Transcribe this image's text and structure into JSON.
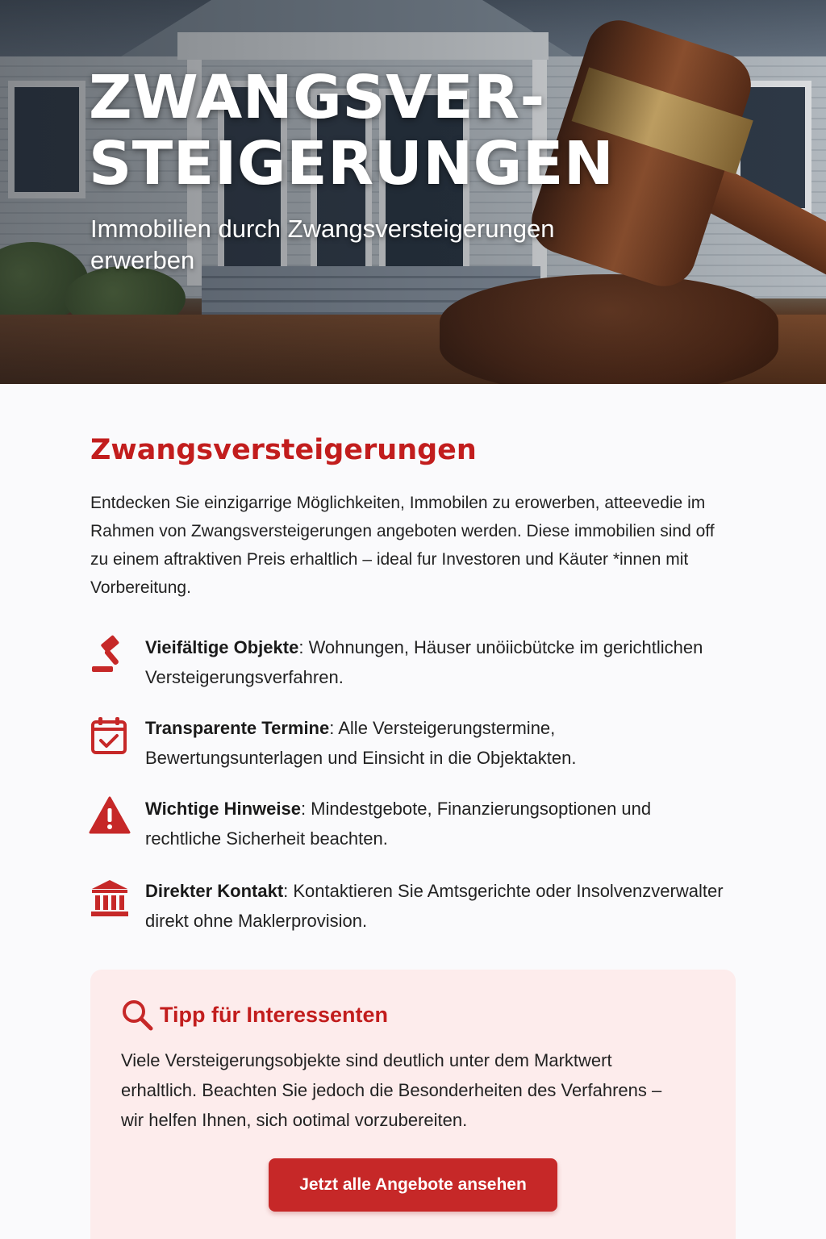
{
  "hero": {
    "title_line1": "ZWANGSVER-",
    "title_line2": "STEIGERUNGEN",
    "subtitle": "Immobilien durch Zwangsversteigerungen erwerben"
  },
  "main": {
    "heading": "Zwangsversteigerungen",
    "intro": "Entdecken Sie einzigarrige Möglichkeiten, Immobilen zu erowerben, atteevedie im Rahmen von Zwangsversteigerungen angeboten werden. Diese immobilien sind off zu einem aftraktiven Preis erhaltlich – ideal fur Investoren und Käuter *innen mit Vorbereitung."
  },
  "features": [
    {
      "icon": "gavel-icon",
      "title": "Vieifältige Objekte",
      "text": ": Wohnungen, Häuser unöiicbütcke im gerichtlichen Versteigerungsverfahren."
    },
    {
      "icon": "calendar-check-icon",
      "title": "Transparente Termine",
      "text": ": Alle Versteigerungstermine, Bewertungsunterlagen und Einsicht in die Objektakten."
    },
    {
      "icon": "warning-icon",
      "title": "Wichtige Hinweise",
      "text": ": Mindestgebote, Finanzierungsoptionen und rechtliche Sicherheit beachten."
    },
    {
      "icon": "courthouse-icon",
      "title": "Direkter Kontakt",
      "text": ": Kontaktieren Sie Amtsgerichte oder Insolvenzverwalter direkt ohne Maklerprovision."
    }
  ],
  "tip": {
    "icon": "search-icon",
    "title": "Tipp für Interessenten",
    "body": "Viele Versteigerungsobjekte sind  deutlich unter dem Marktwert erhaltlich. Beachten Sie jedoch die Besonderheiten des Verfahrens – wir helfen Ihnen, sich ootimal vorzubereiten.",
    "cta_label": "Jetzt alle Angebote ansehen"
  },
  "colors": {
    "accent": "#c21d1d",
    "button": "#c62828",
    "tip_background": "#fdecec"
  }
}
